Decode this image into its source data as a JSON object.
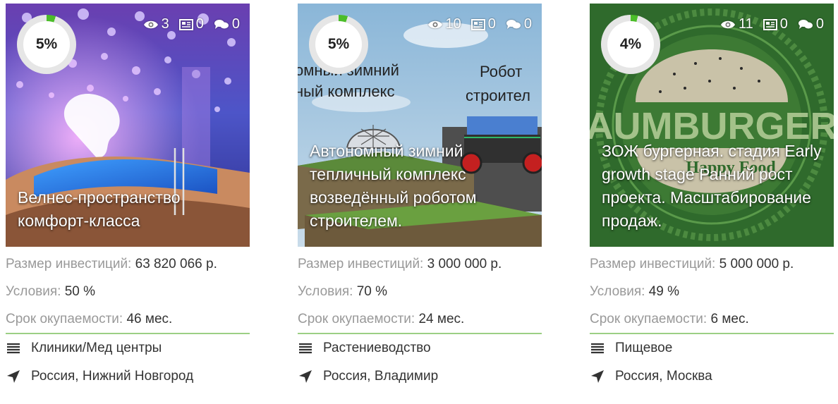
{
  "labels": {
    "investment": "Размер инвестиций:",
    "conditions": "Условия:",
    "payback": "Срок окупаемости:"
  },
  "colors": {
    "progress": "#4cbd2a",
    "ring_track": "#e6e6e6",
    "divider": "#9ccf84",
    "label": "#999999",
    "value": "#333333"
  },
  "cards": [
    {
      "progress_label": "5%",
      "progress": 0.05,
      "views": "3",
      "docs": "0",
      "comments": "0",
      "title": "Велнес-пространство комфорт-класса",
      "investment": "63 820 066 р.",
      "conditions": "50 %",
      "payback": "46 мес.",
      "category": "Клиники/Мед центры",
      "location": "Россия, Нижний Новгород"
    },
    {
      "progress_label": "5%",
      "progress": 0.05,
      "views": "10",
      "docs": "0",
      "comments": "0",
      "title": "Автономный зимний тепличный комплекс возведённый роботом строителем.",
      "image_text": {
        "left_line1": "омный зимний",
        "left_line2": "ный комплекс",
        "right_line1": "Робот",
        "right_line2": "строител"
      },
      "investment": "3 000 000 р.",
      "conditions": "70 %",
      "payback": "24 мес.",
      "category": "Растениеводство",
      "location": "Россия, Владимир"
    },
    {
      "progress_label": "4%",
      "progress": 0.04,
      "views": "11",
      "docs": "0",
      "comments": "0",
      "title": "ЗОЖ бургерная. стадия Early growth stage Ранний рост проекта. Масштабирование продаж.",
      "image_text": {
        "brand": "AUMBURGER",
        "tagline": "Happy Food"
      },
      "investment": "5 000 000 р.",
      "conditions": "49 %",
      "payback": "6 мес.",
      "category": "Пищевое",
      "location": "Россия, Москва"
    }
  ]
}
